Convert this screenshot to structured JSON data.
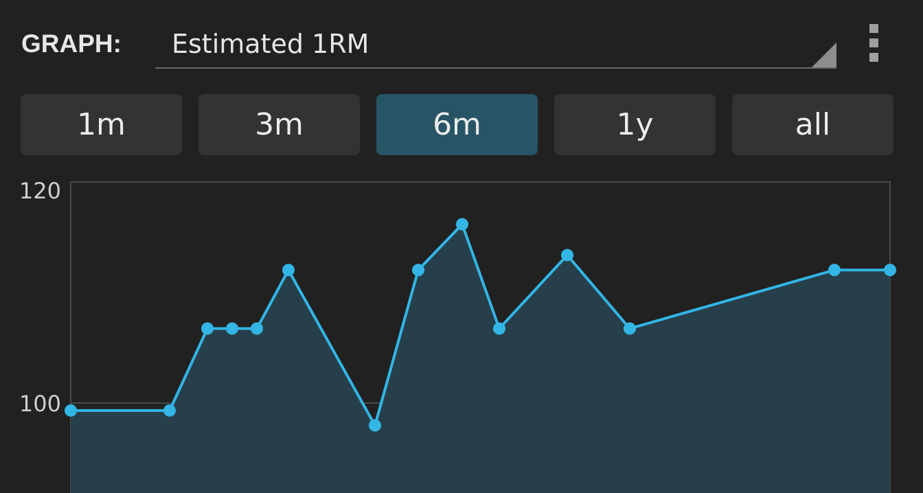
{
  "header": {
    "graph_label": "GRAPH:",
    "graph_type_value": "Estimated 1RM",
    "overflow_icon": "more-vert-icon"
  },
  "range_buttons": [
    {
      "label": "1m",
      "active": false
    },
    {
      "label": "3m",
      "active": false
    },
    {
      "label": "6m",
      "active": true
    },
    {
      "label": "1y",
      "active": false
    },
    {
      "label": "all",
      "active": false
    }
  ],
  "colors": {
    "background": "#212121",
    "button": "#333333",
    "button_active": "#275566",
    "line": "#33b5e5",
    "fill": "#263f4a",
    "grid": "#4a5a60"
  },
  "chart_data": {
    "type": "area",
    "y_ticks": [
      "120",
      "100"
    ],
    "ylim": [
      92,
      120
    ],
    "grid": true,
    "series": [
      {
        "values": [
          99.3,
          99.3,
          107,
          107,
          107,
          112.5,
          97.9,
          112.5,
          116.8,
          107,
          113.9,
          107,
          112.5,
          112.5
        ]
      }
    ]
  }
}
